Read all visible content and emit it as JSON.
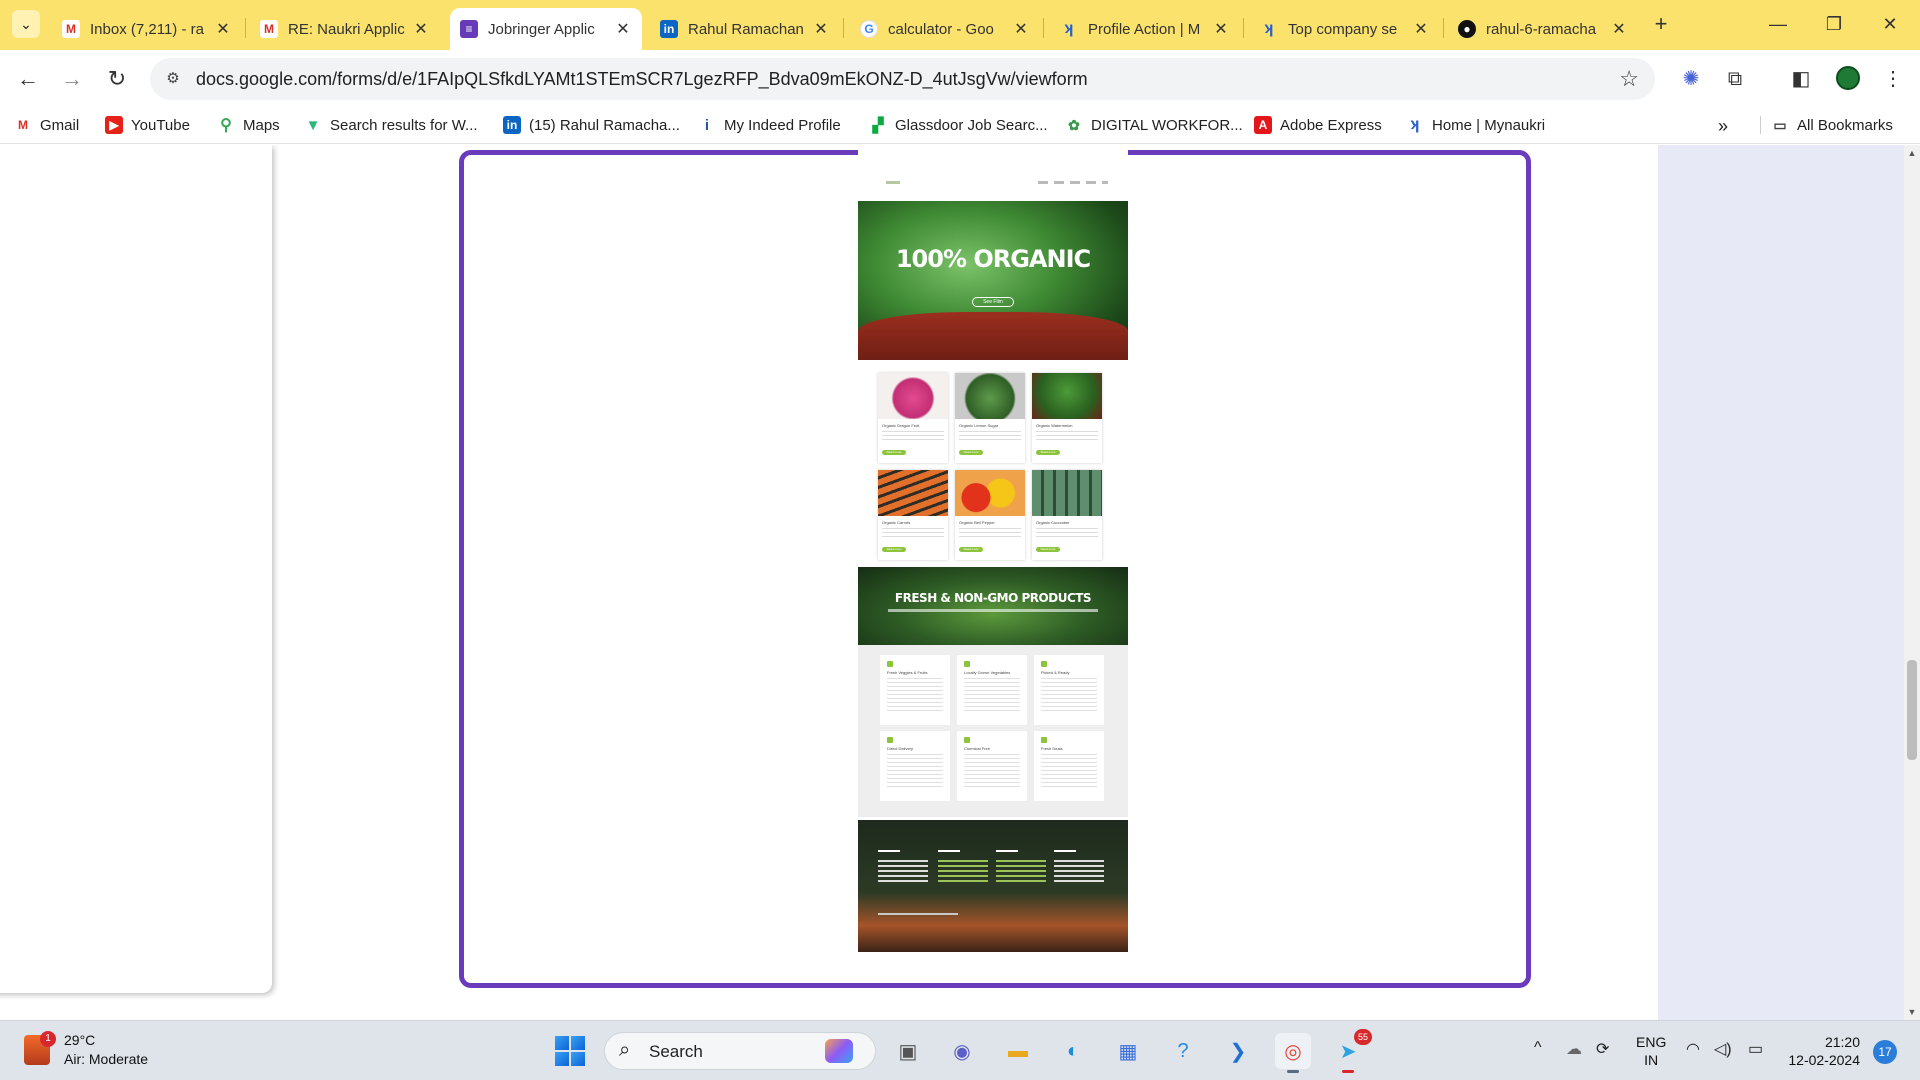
{
  "browser": {
    "tabs": [
      {
        "title": "Inbox (7,211) - ra",
        "favicon": "gmail-icon"
      },
      {
        "title": "RE: Naukri Applic",
        "favicon": "gmail-icon"
      },
      {
        "title": "Jobringer Applic",
        "favicon": "google-forms-icon",
        "active": true
      },
      {
        "title": "Rahul Ramachan",
        "favicon": "linkedin-icon"
      },
      {
        "title": "calculator - Goo",
        "favicon": "google-icon"
      },
      {
        "title": "Profile Action | M",
        "favicon": "naukri-icon"
      },
      {
        "title": "Top company se",
        "favicon": "naukri-icon"
      },
      {
        "title": "rahul-6-ramacha",
        "favicon": "github-icon"
      }
    ],
    "url": "docs.google.com/forms/d/e/1FAIpQLSfkdLYAMt1STEmSCR7LgezRFP_Bdva09mEkONZ-D_4utJsgVw/viewform",
    "bookmarks": [
      {
        "label": "Gmail",
        "icon": "gmail-icon"
      },
      {
        "label": "YouTube",
        "icon": "youtube-icon"
      },
      {
        "label": "Maps",
        "icon": "maps-icon"
      },
      {
        "label": "Search results for W...",
        "icon": "vue-icon"
      },
      {
        "label": "(15) Rahul Ramacha...",
        "icon": "linkedin-icon"
      },
      {
        "label": "My Indeed Profile",
        "icon": "indeed-icon"
      },
      {
        "label": "Glassdoor Job Searc...",
        "icon": "glassdoor-icon"
      },
      {
        "label": "DIGITAL WORKFOR...",
        "icon": "digital-icon"
      },
      {
        "label": "Adobe Express",
        "icon": "adobe-icon"
      },
      {
        "label": "Home | Mynaukri",
        "icon": "naukri-icon"
      }
    ],
    "all_bookmarks": "All Bookmarks"
  },
  "embedded_site": {
    "hero_title": "100% ORGANIC",
    "hero_button": "See Film",
    "products": [
      "Organic Dragon Fruit",
      "Organic Lemon Sugar",
      "Organic Watermelon",
      "Organic Carrots",
      "Organic Bell Pepper",
      "Organic Cucumber"
    ],
    "product_button": "Read more",
    "band_title": "FRESH & NON-GMO PRODUCTS",
    "features": [
      "Fresh Veggies & Fruits",
      "Locally Grown Vegetables",
      "Picked & Ready",
      "Direct Delivery",
      "Chemical Free",
      "Fresh Deals"
    ]
  },
  "taskbar": {
    "weather_temp": "29°C",
    "weather_desc": "Air: Moderate",
    "weather_badge": "1",
    "search_label": "Search",
    "telegram_badge": "55",
    "lang_1": "ENG",
    "lang_2": "IN",
    "time": "21:20",
    "date": "12-02-2024",
    "notifications": "17"
  },
  "colors": {
    "tabstrip": "#fbe26d",
    "frame_border": "#6a3cbc",
    "accent_green": "#8cc43e"
  }
}
